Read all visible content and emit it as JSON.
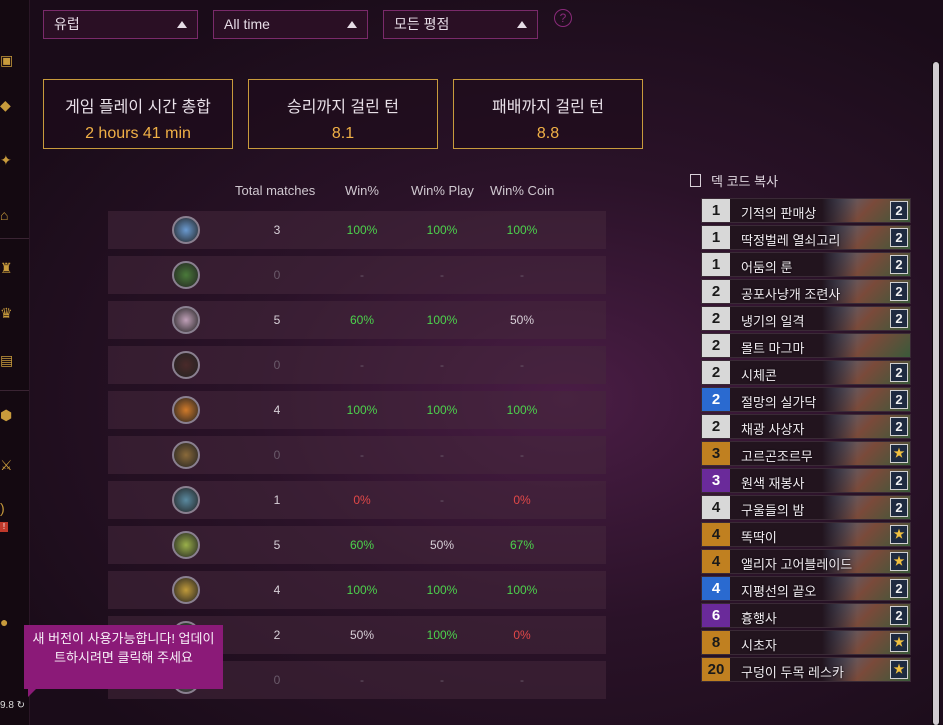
{
  "filters": {
    "region": "유럽",
    "time": "All time",
    "rank": "모든 평점",
    "help": "?"
  },
  "stats": [
    {
      "label": "게임 플레이 시간 총합",
      "value": "2 hours 41 min"
    },
    {
      "label": "승리까지 걸린 턴",
      "value": "8.1"
    },
    {
      "label": "패배까지 걸린 턴",
      "value": "8.8"
    }
  ],
  "table": {
    "headers": [
      "Total matches",
      "Win%",
      "Win% Play",
      "Win% Coin"
    ],
    "rows": [
      {
        "icon": "class-mage-icon",
        "matches": "3",
        "win": "100%",
        "play": "100%",
        "coin": "100%"
      },
      {
        "icon": "class-hunter-icon",
        "matches": "0",
        "win": "-",
        "play": "-",
        "coin": "-"
      },
      {
        "icon": "class-priest-icon",
        "matches": "5",
        "win": "60%",
        "play": "100%",
        "coin": "50%"
      },
      {
        "icon": "class-warlock-icon",
        "matches": "0",
        "win": "-",
        "play": "-",
        "coin": "-"
      },
      {
        "icon": "class-rogue-icon",
        "matches": "4",
        "win": "100%",
        "play": "100%",
        "coin": "100%"
      },
      {
        "icon": "class-warrior-icon",
        "matches": "0",
        "win": "-",
        "play": "-",
        "coin": "-"
      },
      {
        "icon": "class-shaman-icon",
        "matches": "1",
        "win": "0%",
        "play": "-",
        "coin": "0%"
      },
      {
        "icon": "class-druid-icon",
        "matches": "5",
        "win": "60%",
        "play": "50%",
        "coin": "67%"
      },
      {
        "icon": "class-paladin-icon",
        "matches": "4",
        "win": "100%",
        "play": "100%",
        "coin": "100%"
      },
      {
        "icon": "class-demonhunter-icon",
        "matches": "2",
        "win": "50%",
        "play": "100%",
        "coin": "0%"
      },
      {
        "icon": "class-deathknight-icon",
        "matches": "0",
        "win": "-",
        "play": "-",
        "coin": "-"
      }
    ]
  },
  "deck": {
    "copy_label": "덱 코드 복사",
    "cards": [
      {
        "cost": "1",
        "name": "기적의 판매상",
        "count": "2",
        "rarity": "common"
      },
      {
        "cost": "1",
        "name": "딱정벌레 열쇠고리",
        "count": "2",
        "rarity": "common"
      },
      {
        "cost": "1",
        "name": "어둠의 룬",
        "count": "2",
        "rarity": "common"
      },
      {
        "cost": "2",
        "name": "공포사냥개 조련사",
        "count": "2",
        "rarity": "common"
      },
      {
        "cost": "2",
        "name": "냉기의 일격",
        "count": "2",
        "rarity": "common"
      },
      {
        "cost": "2",
        "name": "몰트 마그마",
        "count": "",
        "rarity": "common"
      },
      {
        "cost": "2",
        "name": "시체콘",
        "count": "2",
        "rarity": "common"
      },
      {
        "cost": "2",
        "name": "절망의 실가닥",
        "count": "2",
        "rarity": "rare"
      },
      {
        "cost": "2",
        "name": "채광 사상자",
        "count": "2",
        "rarity": "common"
      },
      {
        "cost": "3",
        "name": "고르곤조르무",
        "count": "★",
        "rarity": "legendary"
      },
      {
        "cost": "3",
        "name": "원색 재봉사",
        "count": "2",
        "rarity": "epic"
      },
      {
        "cost": "4",
        "name": "구울들의 밤",
        "count": "2",
        "rarity": "common"
      },
      {
        "cost": "4",
        "name": "똑딱이",
        "count": "★",
        "rarity": "legendary"
      },
      {
        "cost": "4",
        "name": "앨리자 고어블레이드",
        "count": "★",
        "rarity": "legendary"
      },
      {
        "cost": "4",
        "name": "지평선의 끝오",
        "count": "2",
        "rarity": "rare"
      },
      {
        "cost": "6",
        "name": "흉행사",
        "count": "2",
        "rarity": "epic"
      },
      {
        "cost": "8",
        "name": "시초자",
        "count": "★",
        "rarity": "legendary"
      },
      {
        "cost": "20",
        "name": "구덩이 두목 레스카",
        "count": "★",
        "rarity": "legendary"
      }
    ]
  },
  "toast": {
    "text": "새 버전이 사용가능합니다! 업데이트하시려면 클릭해 주세요"
  },
  "version": "9.8",
  "colors": {
    "accent": "#c89b3c",
    "win": "#4cd34c",
    "loss": "#e04848",
    "toast": "#8b1a78"
  }
}
